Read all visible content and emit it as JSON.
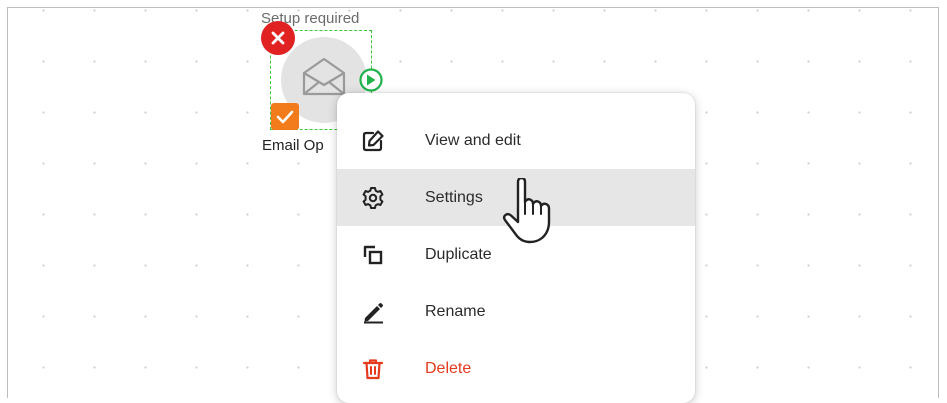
{
  "node": {
    "status_text": "Setup required",
    "label": "Email Op",
    "icon": "envelope-icon",
    "error_badge_icon": "close-icon",
    "check_badge_icon": "checkmark-icon",
    "output_icon": "arrow-right-circle-icon"
  },
  "context_menu": {
    "items": [
      {
        "label": "View and edit",
        "icon": "edit-icon"
      },
      {
        "label": "Settings",
        "icon": "gear-icon",
        "state": "hovered"
      },
      {
        "label": "Duplicate",
        "icon": "duplicate-icon"
      },
      {
        "label": "Rename",
        "icon": "pencil-icon"
      },
      {
        "label": "Delete",
        "icon": "trash-icon",
        "color": "#e53a1d"
      }
    ]
  },
  "colors": {
    "error": "#e02222",
    "check": "#f27b1c",
    "selection": "#3cc83c",
    "danger": "#e53a1d",
    "hover": "#e6e6e6"
  },
  "cursor": {
    "icon": "hand-pointer-icon"
  }
}
